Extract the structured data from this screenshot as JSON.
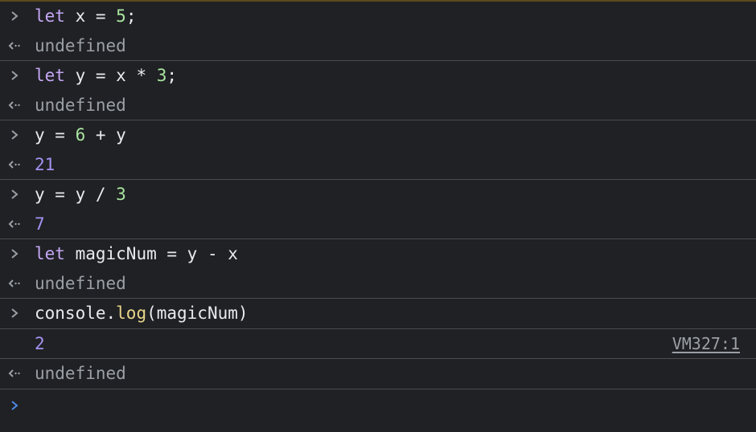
{
  "entries": [
    {
      "input": [
        "let",
        " x = ",
        "5",
        ";"
      ],
      "output": "undefined"
    },
    {
      "input": [
        "let",
        " y = x * ",
        "3",
        ";"
      ],
      "output": "undefined"
    },
    {
      "input": [
        "y = ",
        "6",
        " + y"
      ],
      "output": "21"
    },
    {
      "input": [
        "y = y / ",
        "3"
      ],
      "output": "7"
    },
    {
      "input": [
        "let",
        " magicNum = y - x"
      ],
      "output": "undefined"
    },
    {
      "input": [
        "console.",
        "log",
        "(magicNum)"
      ],
      "log_value": "2",
      "log_source": "VM327:1",
      "output": "undefined"
    }
  ],
  "icons": {
    "input_prompt": "chevron-right-icon",
    "result": "return-arrow-icon",
    "active_prompt": "chevron-right-icon"
  },
  "colors": {
    "background": "#202124",
    "keyword": "#c4a7f5",
    "number": "#a8e5a0",
    "function": "#e8d58a",
    "result_number": "#a592f2",
    "undefined": "#9aa0a6",
    "active_prompt": "#4d8ae6"
  }
}
